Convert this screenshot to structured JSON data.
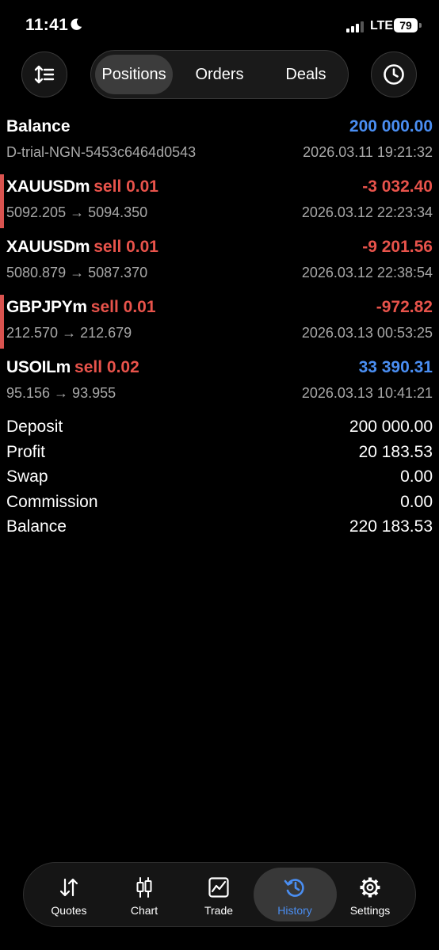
{
  "status": {
    "time": "11:41",
    "network": "LTE",
    "battery": "79"
  },
  "header": {
    "sort_icon": "sort-arrows-icon",
    "tabs": [
      {
        "label": "Positions"
      },
      {
        "label": "Orders"
      },
      {
        "label": "Deals"
      }
    ],
    "active_tab": "Positions",
    "period_icon": "clock-icon"
  },
  "balance_row": {
    "title": "Balance",
    "amount": "200 000.00",
    "account": "D-trial-NGN-5453c6464d0543",
    "datetime": "2026.03.11 19:21:32"
  },
  "trades": [
    {
      "symbol": "XAUUSDm",
      "action": "sell 0.01",
      "profit": "-3 032.40",
      "prices": "5092.205 → 5094.350",
      "datetime": "2026.03.12 22:23:34",
      "marked": true
    },
    {
      "symbol": "XAUUSDm",
      "action": "sell 0.01",
      "profit": "-9 201.56",
      "prices": "5080.879 → 5087.370",
      "datetime": "2026.03.12 22:38:54",
      "marked": false
    },
    {
      "symbol": "GBPJPYm",
      "action": "sell 0.01",
      "profit": "-972.82",
      "prices": "212.570 → 212.679",
      "datetime": "2026.03.13 00:53:25",
      "marked": true
    },
    {
      "symbol": "USOILm",
      "action": "sell 0.02",
      "profit": "33 390.31",
      "prices": "95.156 → 93.955",
      "datetime": "2026.03.13 10:41:21",
      "marked": false
    }
  ],
  "summary": [
    {
      "label": "Deposit",
      "value": "200 000.00"
    },
    {
      "label": "Profit",
      "value": "20 183.53"
    },
    {
      "label": "Swap",
      "value": "0.00"
    },
    {
      "label": "Commission",
      "value": "0.00"
    },
    {
      "label": "Balance",
      "value": "220 183.53"
    }
  ],
  "nav": {
    "items": [
      {
        "label": "Quotes",
        "icon": "quotes-arrows-icon"
      },
      {
        "label": "Chart",
        "icon": "candlestick-icon"
      },
      {
        "label": "Trade",
        "icon": "trade-chart-icon"
      },
      {
        "label": "History",
        "icon": "history-icon"
      },
      {
        "label": "Settings",
        "icon": "gear-icon"
      }
    ],
    "active": "History"
  },
  "colors": {
    "loss": "#e8534b",
    "profit": "#4a8ef2",
    "accent": "#4a8ef2",
    "background": "#000000"
  }
}
